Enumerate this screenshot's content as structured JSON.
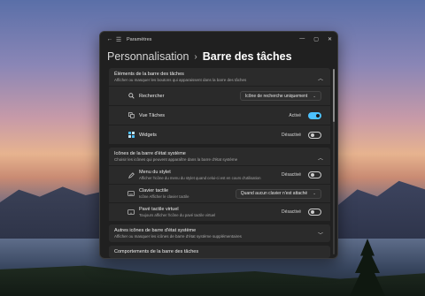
{
  "window": {
    "title": "Paramètres",
    "controls": [
      "—",
      "▢",
      "✕"
    ]
  },
  "breadcrumb": {
    "parent": "Personnalisation",
    "separator": "›",
    "current": "Barre des tâches"
  },
  "sections": {
    "taskbar_items": {
      "title": "Éléments de la barre des tâches",
      "subtitle": "Afficher ou masquer les boutons qui apparaissent dans la barre des tâches",
      "rows": {
        "search": {
          "label": "Rechercher",
          "value": "Icône de recherche uniquement",
          "icon": "search-icon"
        },
        "task_view": {
          "label": "Vue Tâches",
          "state": "Activé",
          "on": true,
          "icon": "task-view-icon"
        },
        "widgets": {
          "label": "Widgets",
          "state": "Désactivé",
          "on": false,
          "icon": "widgets-icon"
        }
      }
    },
    "system_tray": {
      "title": "Icônes de la barre d'état système",
      "subtitle": "Choisir les icônes qui peuvent apparaître dans la barre d'état système",
      "rows": {
        "pen_menu": {
          "label": "Menu du stylet",
          "sub": "Afficher l'icône du menu du stylet quand celui-ci est en cours d'utilisation",
          "state": "Désactivé",
          "on": false,
          "icon": "pen-icon"
        },
        "touch_keyboard": {
          "label": "Clavier tactile",
          "sub": "Icône Afficher le clavier tactile",
          "value": "Quand aucun clavier n'est attaché",
          "icon": "keyboard-icon"
        },
        "touchpad": {
          "label": "Pavé tactile virtuel",
          "sub": "Toujours afficher l'icône du pavé tactile virtuel",
          "state": "Désactivé",
          "on": false,
          "icon": "touchpad-icon"
        }
      }
    },
    "other_tray": {
      "title": "Autres icônes de barre d'état système",
      "subtitle": "Afficher ou masquer les icônes de barre d'état système supplémentaires"
    },
    "behaviors": {
      "title": "Comportements de la barre des tâches"
    }
  },
  "colors": {
    "accent": "#4cc2ff",
    "window_bg": "#202020",
    "card_bg": "#2b2b2b"
  }
}
